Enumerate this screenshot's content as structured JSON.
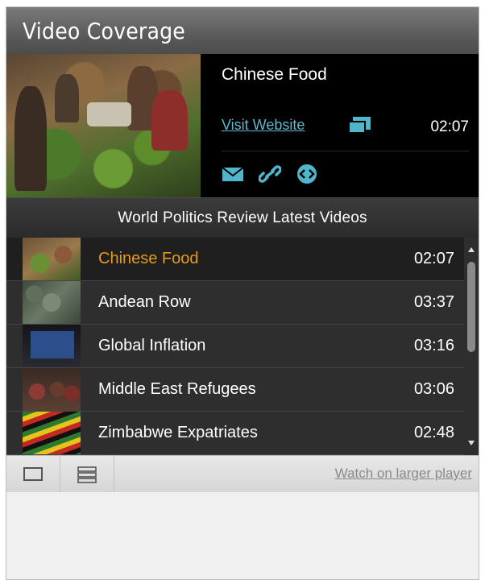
{
  "widget": {
    "title": "Video Coverage"
  },
  "feature": {
    "title": "Chinese Food",
    "visit_label": "Visit Website",
    "duration": "02:07",
    "share_icons": [
      "email-icon",
      "link-icon",
      "embed-icon"
    ]
  },
  "list": {
    "header": "World Politics Review Latest Videos",
    "items": [
      {
        "title": "Chinese Food",
        "duration": "02:07",
        "active": true
      },
      {
        "title": "Andean Row",
        "duration": "03:37",
        "active": false
      },
      {
        "title": "Global Inflation",
        "duration": "03:16",
        "active": false
      },
      {
        "title": "Middle East Refugees",
        "duration": "03:06",
        "active": false
      },
      {
        "title": "Zimbabwe Expatriates",
        "duration": "02:48",
        "active": false
      }
    ]
  },
  "footer": {
    "larger_label": "Watch on larger player"
  },
  "colors": {
    "accent": "#5fb8cc",
    "active_title": "#e59a1a"
  }
}
